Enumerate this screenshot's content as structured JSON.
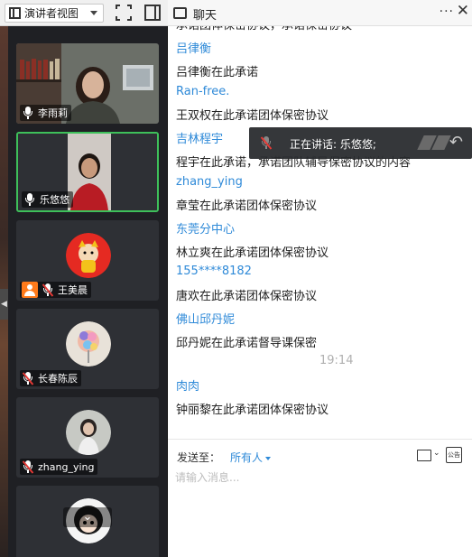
{
  "toolbar": {
    "view_label": "演讲者视图"
  },
  "participants": [
    {
      "name": "李雨莉",
      "mic": "on",
      "host": false
    },
    {
      "name": "乐悠悠",
      "mic": "on",
      "host": false,
      "active": true
    },
    {
      "name": "王美晨",
      "mic": "muted",
      "host": true
    },
    {
      "name": "长春陈辰",
      "mic": "muted",
      "host": false
    },
    {
      "name": "zhang_ying",
      "mic": "muted",
      "host": false
    },
    {
      "name": "",
      "mic": "muted",
      "host": false
    }
  ],
  "chat": {
    "title": "聊天",
    "messages": [
      {
        "sender": "吕律衡",
        "text": "吕律衡在此承诺"
      },
      {
        "sender": "Ran-free.",
        "text": "王双权在此承诺团体保密协议"
      },
      {
        "sender": "吉林程宇",
        "text": "程宇在此承诺，承诺团队辅导保密协议的内容"
      },
      {
        "sender": "zhang_ying",
        "text": "章莹在此承诺团体保密协议"
      },
      {
        "sender": "东莞分中心",
        "text": "林立爽在此承诺团体保密协议"
      },
      {
        "sender": "155****8182",
        "text": "唐欢在此承诺团体保密协议"
      },
      {
        "sender": "佛山邱丹妮",
        "text": "邱丹妮在此承诺督导课保密"
      },
      {
        "sender": "肉肉",
        "text": "钟丽黎在此承诺团体保密协议"
      }
    ],
    "time": "19:14",
    "speaking": "正在讲话: 乐悠悠;",
    "send_label": "发送至：",
    "send_target": "所有人",
    "input_placeholder": "请输入消息...",
    "board_icon_text": "公告"
  },
  "colors": {
    "sender": "#2f8ad8",
    "active_border": "#3ec05a",
    "host_badge": "#ff7a1a"
  }
}
